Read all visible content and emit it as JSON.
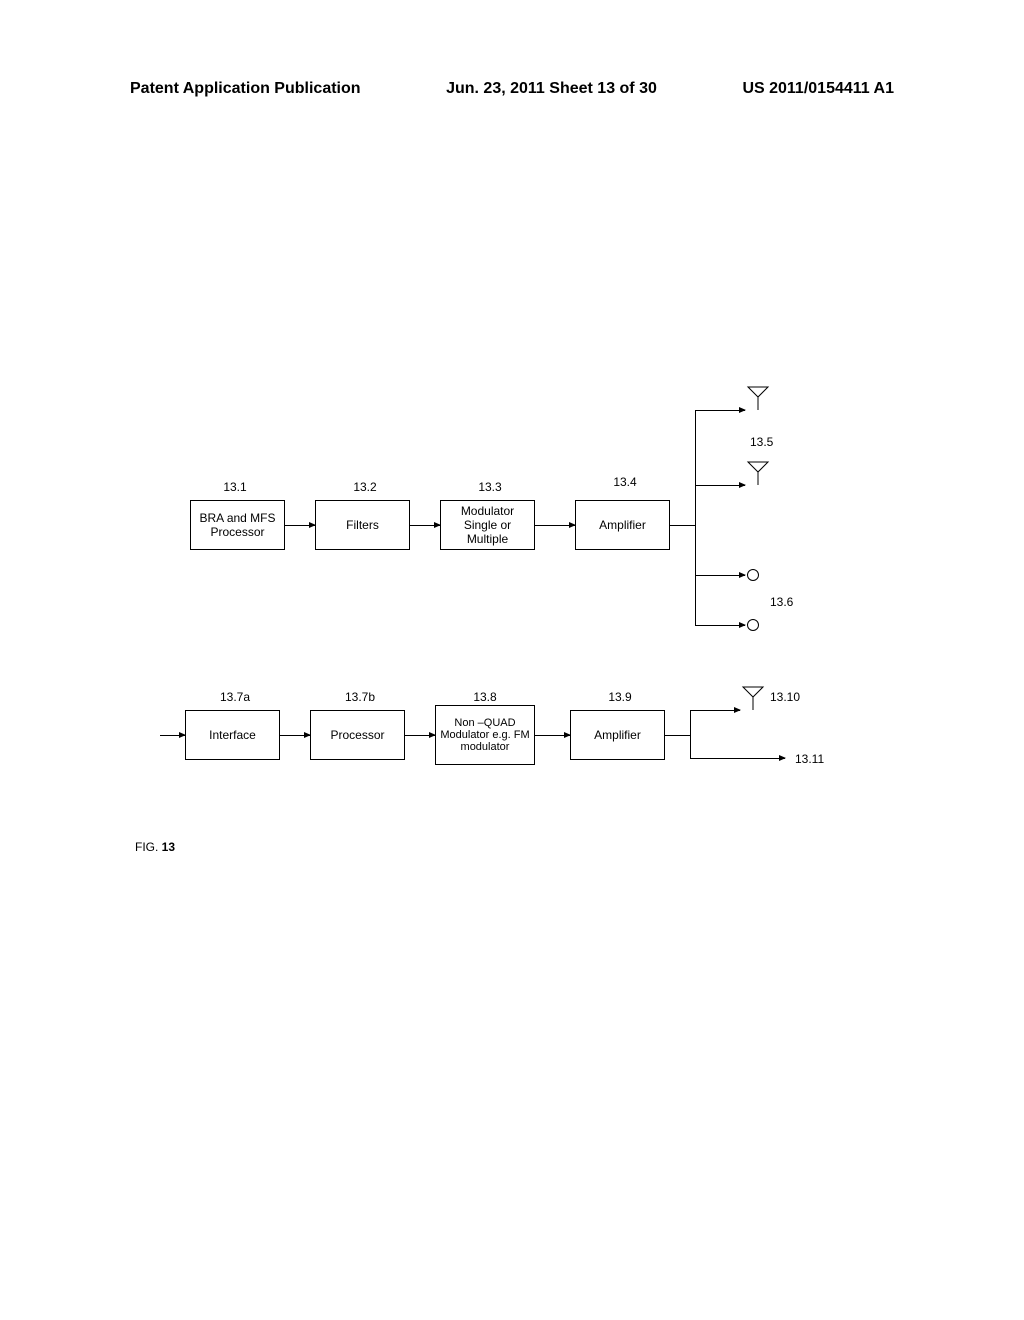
{
  "header": {
    "left": "Patent Application Publication",
    "center": "Jun. 23, 2011  Sheet 13 of 30",
    "right": "US 2011/0154411 A1"
  },
  "top_chain": {
    "block1": {
      "label": "13.1",
      "text": "BRA and MFS Processor"
    },
    "block2": {
      "label": "13.2",
      "text": "Filters"
    },
    "block3": {
      "label": "13.3",
      "text": "Modulator Single or Multiple"
    },
    "block4": {
      "label": "13.4",
      "text": "Amplifier"
    },
    "output_antenna_label": "13.5",
    "output_circle_label": "13.6"
  },
  "bottom_chain": {
    "block1": {
      "label": "13.7a",
      "text": "Interface"
    },
    "block2": {
      "label": "13.7b",
      "text": "Processor"
    },
    "block3": {
      "label": "13.8",
      "text": "Non –QUAD Modulator e.g. FM modulator"
    },
    "block4": {
      "label": "13.9",
      "text": "Amplifier"
    },
    "output_antenna_label": "13.10",
    "output_line_label": "13.11"
  },
  "figure_label": "FIG. 13"
}
